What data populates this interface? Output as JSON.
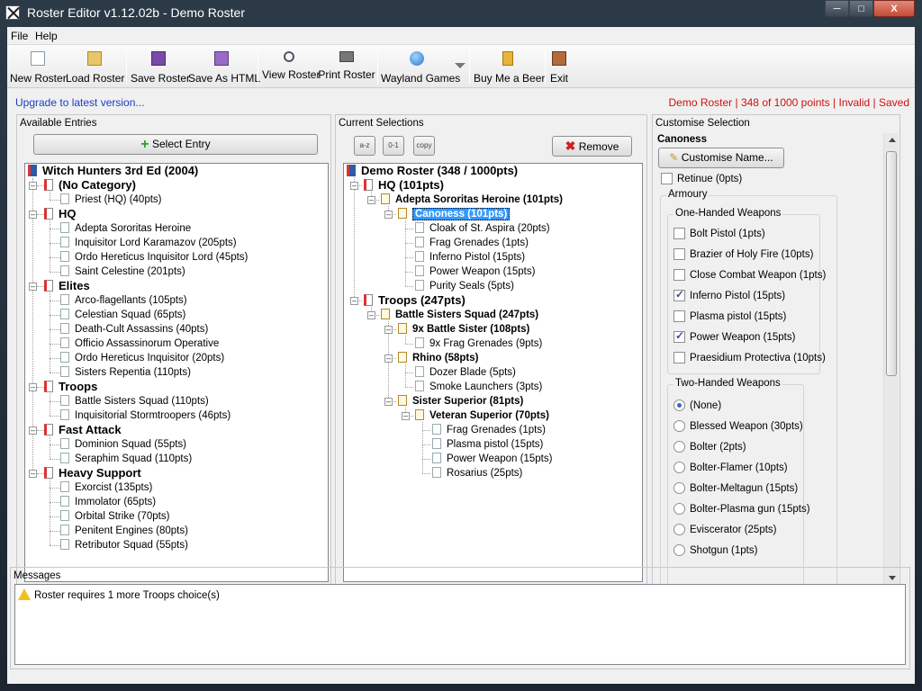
{
  "window": {
    "title": "Roster Editor v1.12.02b - Demo Roster",
    "buttons": [
      "─",
      "□",
      "X"
    ]
  },
  "menu": [
    "File",
    "Help"
  ],
  "toolbar": [
    {
      "label": "New Roster",
      "icon": "new-document-icon"
    },
    {
      "label": "Load Roster",
      "icon": "folder-icon"
    },
    {
      "label": "Save Roster",
      "icon": "save-disk-icon"
    },
    {
      "label": "Save As HTML",
      "icon": "save-html-icon"
    },
    {
      "label": "View Roster",
      "icon": "magnifier-icon"
    },
    {
      "label": "Print Roster",
      "icon": "printer-icon"
    },
    {
      "label": "Wayland Games",
      "icon": "globe-icon"
    },
    {
      "label": "Buy Me a Beer",
      "icon": "beer-icon"
    },
    {
      "label": "Exit",
      "icon": "exit-door-icon"
    }
  ],
  "status": {
    "upgrade": "Upgrade to latest version...",
    "roster": "Demo Roster | 348 of 1000 points | Invalid | Saved",
    "color": "#d01010"
  },
  "available": {
    "title": "Available Entries",
    "select_button": "Select Entry",
    "root": "Witch Hunters 3rd Ed (2004)",
    "categories": [
      {
        "name": "(No Category)",
        "items": [
          "Priest (HQ) (40pts)"
        ]
      },
      {
        "name": "HQ",
        "items": [
          "Adepta Sororitas Heroine",
          "Inquisitor Lord Karamazov (205pts)",
          "Ordo Hereticus Inquisitor Lord (45pts)",
          "Saint Celestine (201pts)"
        ]
      },
      {
        "name": "Elites",
        "items": [
          "Arco-flagellants (105pts)",
          "Celestian Squad (65pts)",
          "Death-Cult Assassins (40pts)",
          "Officio Assassinorum Operative",
          "Ordo Hereticus Inquisitor (20pts)",
          "Sisters Repentia (110pts)"
        ]
      },
      {
        "name": "Troops",
        "items": [
          "Battle Sisters Squad (110pts)",
          "Inquisitorial Stormtroopers (46pts)"
        ]
      },
      {
        "name": "Fast Attack",
        "items": [
          "Dominion Squad (55pts)",
          "Seraphim Squad (110pts)"
        ]
      },
      {
        "name": "Heavy Support",
        "items": [
          "Exorcist (135pts)",
          "Immolator (65pts)",
          "Orbital Strike (70pts)",
          "Penitent Engines (80pts)",
          "Retributor Squad (55pts)"
        ]
      }
    ]
  },
  "current": {
    "title": "Current Selections",
    "sort_buttons": [
      "a-z",
      "0-1",
      "copy"
    ],
    "remove_button": "Remove",
    "rows": [
      {
        "text": "Demo Roster (348 / 1000pts)",
        "level": 0,
        "kind": "root"
      },
      {
        "text": "HQ (101pts)",
        "level": 1,
        "kind": "cat"
      },
      {
        "text": "Adepta Sororitas Heroine (101pts)",
        "level": 2,
        "kind": "bold"
      },
      {
        "text": "Canoness (101pts)",
        "level": 3,
        "kind": "sel"
      },
      {
        "text": "Cloak of St. Aspira (20pts)",
        "level": 4,
        "kind": "item"
      },
      {
        "text": "Frag Grenades (1pts)",
        "level": 4,
        "kind": "item"
      },
      {
        "text": "Inferno Pistol (15pts)",
        "level": 4,
        "kind": "item"
      },
      {
        "text": "Power Weapon (15pts)",
        "level": 4,
        "kind": "item"
      },
      {
        "text": "Purity Seals (5pts)",
        "level": 4,
        "kind": "item"
      },
      {
        "text": "Troops (247pts)",
        "level": 1,
        "kind": "cat"
      },
      {
        "text": "Battle Sisters Squad (247pts)",
        "level": 2,
        "kind": "bold"
      },
      {
        "text": "9x Battle Sister (108pts)",
        "level": 3,
        "kind": "bold"
      },
      {
        "text": "9x Frag Grenades (9pts)",
        "level": 4,
        "kind": "item"
      },
      {
        "text": "Rhino (58pts)",
        "level": 3,
        "kind": "bold"
      },
      {
        "text": "Dozer Blade (5pts)",
        "level": 4,
        "kind": "item"
      },
      {
        "text": "Smoke Launchers (3pts)",
        "level": 4,
        "kind": "item"
      },
      {
        "text": "Sister Superior (81pts)",
        "level": 3,
        "kind": "bold"
      },
      {
        "text": "Veteran Superior (70pts)",
        "level": 4,
        "kind": "bold"
      },
      {
        "text": "Frag Grenades (1pts)",
        "level": 5,
        "kind": "item"
      },
      {
        "text": "Plasma pistol (15pts)",
        "level": 5,
        "kind": "item"
      },
      {
        "text": "Power Weapon (15pts)",
        "level": 5,
        "kind": "item"
      },
      {
        "text": "Rosarius (25pts)",
        "level": 5,
        "kind": "item"
      }
    ]
  },
  "customise": {
    "title": "Customise Selection",
    "unit_name": "Canoness",
    "customise_name_button": "Customise Name...",
    "retinue": {
      "label": "Retinue (0pts)",
      "checked": false
    },
    "armoury_label": "Armoury",
    "one_handed": {
      "label": "One-Handed Weapons",
      "items": [
        {
          "label": "Bolt Pistol (1pts)",
          "checked": false
        },
        {
          "label": "Brazier of Holy Fire (10pts)",
          "checked": false
        },
        {
          "label": "Close Combat Weapon (1pts)",
          "checked": false
        },
        {
          "label": "Inferno Pistol (15pts)",
          "checked": true
        },
        {
          "label": "Plasma pistol (15pts)",
          "checked": false
        },
        {
          "label": "Power Weapon (15pts)",
          "checked": true
        },
        {
          "label": "Praesidium Protectiva (10pts)",
          "checked": false
        }
      ]
    },
    "two_handed": {
      "label": "Two-Handed Weapons",
      "items": [
        {
          "label": "(None)",
          "checked": true
        },
        {
          "label": "Blessed Weapon (30pts)",
          "checked": false
        },
        {
          "label": "Bolter (2pts)",
          "checked": false
        },
        {
          "label": "Bolter-Flamer (10pts)",
          "checked": false
        },
        {
          "label": "Bolter-Meltagun (15pts)",
          "checked": false
        },
        {
          "label": "Bolter-Plasma gun (15pts)",
          "checked": false
        },
        {
          "label": "Eviscerator (25pts)",
          "checked": false
        },
        {
          "label": "Shotgun (1pts)",
          "checked": false
        }
      ]
    }
  },
  "messages": {
    "title": "Messages",
    "items": [
      "Roster requires 1 more Troops choice(s)"
    ]
  }
}
